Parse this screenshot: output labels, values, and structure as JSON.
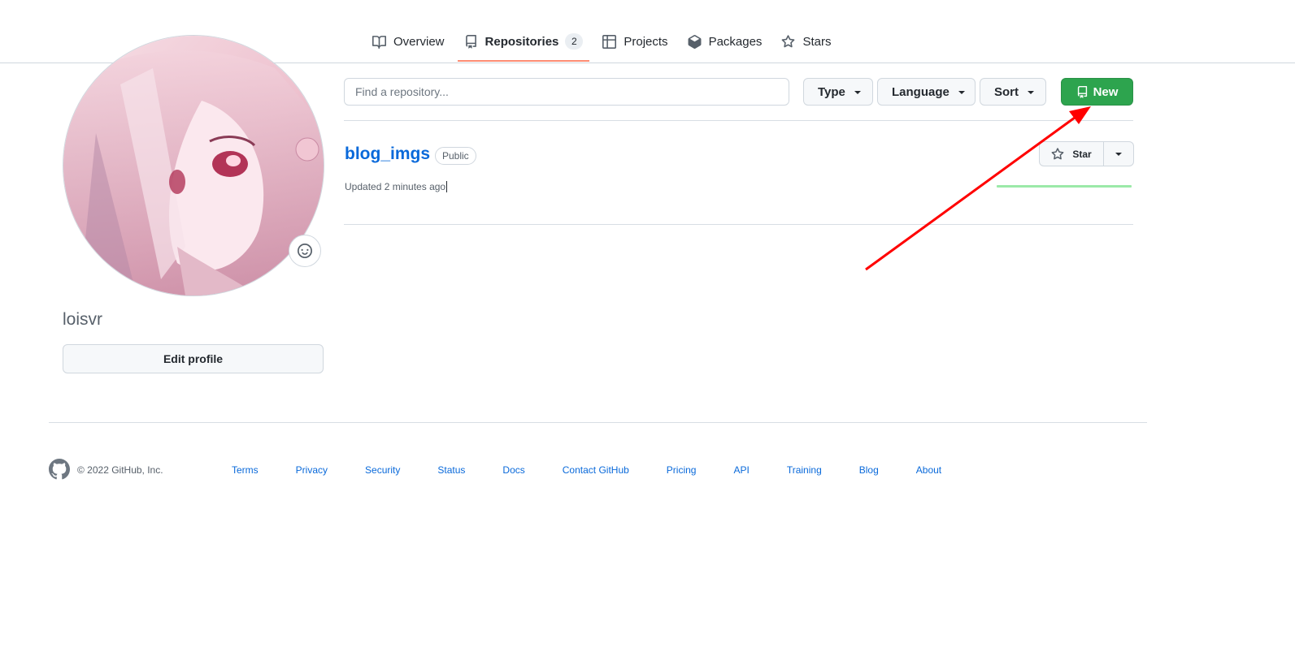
{
  "nav": {
    "tabs": [
      {
        "label": "Overview",
        "icon": "book-icon"
      },
      {
        "label": "Repositories",
        "icon": "repo-icon",
        "count": "2",
        "active": true
      },
      {
        "label": "Projects",
        "icon": "table-icon"
      },
      {
        "label": "Packages",
        "icon": "package-icon"
      },
      {
        "label": "Stars",
        "icon": "star-icon"
      }
    ]
  },
  "profile": {
    "username": "loisvr",
    "edit_label": "Edit profile",
    "status_icon": "smiley-icon"
  },
  "filters": {
    "search_placeholder": "Find a repository...",
    "type_label": "Type",
    "language_label": "Language",
    "sort_label": "Sort",
    "new_label": "New"
  },
  "repos": [
    {
      "name": "blog_imgs",
      "visibility": "Public",
      "updated": "Updated 2 minutes ago",
      "star_label": "Star"
    }
  ],
  "footer": {
    "copyright": "© 2022 GitHub, Inc.",
    "links": [
      "Terms",
      "Privacy",
      "Security",
      "Status",
      "Docs",
      "Contact GitHub",
      "Pricing",
      "API",
      "Training",
      "Blog",
      "About"
    ]
  },
  "colors": {
    "accent_link": "#0969da",
    "new_button": "#2da44e",
    "active_tab_underline": "#fd8c73",
    "annotation_arrow": "#ff0000"
  }
}
